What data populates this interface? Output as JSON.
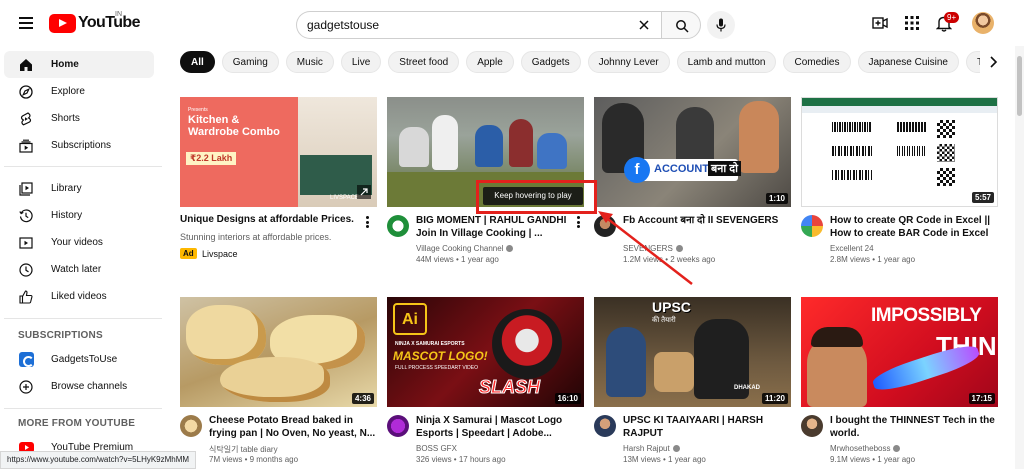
{
  "header": {
    "logo_text": "YouTube",
    "logo_region": "IN",
    "search_value": "gadgetstouse",
    "notification_count": "9+"
  },
  "sidebar": {
    "primary": [
      {
        "label": "Home",
        "icon": "home-icon",
        "active": true
      },
      {
        "label": "Explore",
        "icon": "compass-icon"
      },
      {
        "label": "Shorts",
        "icon": "shorts-icon"
      },
      {
        "label": "Subscriptions",
        "icon": "subscriptions-icon"
      }
    ],
    "library": [
      {
        "label": "Library",
        "icon": "library-icon"
      },
      {
        "label": "History",
        "icon": "history-icon"
      },
      {
        "label": "Your videos",
        "icon": "your-videos-icon"
      },
      {
        "label": "Watch later",
        "icon": "clock-icon"
      },
      {
        "label": "Liked videos",
        "icon": "thumbs-up-icon"
      }
    ],
    "subscriptions_heading": "SUBSCRIPTIONS",
    "subscriptions": [
      {
        "label": "GadgetsToUse",
        "icon": "channel-logo"
      },
      {
        "label": "Browse channels",
        "icon": "add-circle-icon"
      }
    ],
    "more_heading": "MORE FROM YOUTUBE",
    "more": [
      {
        "label": "YouTube Premium",
        "icon": "youtube-icon"
      }
    ]
  },
  "chips": [
    "All",
    "Gaming",
    "Music",
    "Live",
    "Street food",
    "Apple",
    "Gadgets",
    "Johnny Lever",
    "Lamb and mutton",
    "Comedies",
    "Japanese Cuisine",
    "Trailers"
  ],
  "ad": {
    "thumb_small": "Presents",
    "thumb_headline": "Kitchen & Wardrobe Combo",
    "thumb_price": "₹2.2 Lakh",
    "thumb_brand": "LIVSPACE",
    "title": "Unique Designs at affordable Prices.",
    "description": "Stunning interiors at affordable prices.",
    "badge": "Ad",
    "brand": "Livspace"
  },
  "videos": [
    {
      "title": "BIG MOMENT | RAHUL GANDHI Join In Village Cooking | ...",
      "channel": "Village Cooking Channel",
      "meta": "44M views • 1 year ago",
      "duration": "",
      "verified": true
    },
    {
      "title": "Fb Account बना दो II SEVENGERS",
      "channel": "SEVENGERS",
      "meta": "1.2M views • 2 weeks ago",
      "duration": "1:10",
      "verified": true,
      "thumb_text": "ACCOUNT",
      "thumb_text_hi": "बना दो"
    },
    {
      "title": "How to create QR Code in Excel || How to create BAR Code in Excel ...",
      "channel": "Excellent 24",
      "meta": "2.8M views • 1 year ago",
      "duration": "5:57",
      "verified": false
    },
    {
      "title": "Cheese Potato Bread baked in frying pan | No Oven, No yeast, N...",
      "channel": "식탁일기 table diary",
      "meta": "7M views • 9 months ago",
      "duration": "4:36",
      "verified": false
    },
    {
      "title": "Ninja X Samurai | Mascot Logo Esports | Speedart | Adobe...",
      "channel": "BOSS GFX",
      "meta": "326 views • 17 hours ago",
      "duration": "16:10",
      "verified": false,
      "thumb_small": "NINJA X SAMURAI ESPORTS",
      "thumb_big": "MASCOT LOGO!",
      "thumb_sub": "FULL PROCESS SPEEDART VIDEO",
      "thumb_slash": "SLASH"
    },
    {
      "title": "UPSC KI TAAIYAARI | HARSH RAJPUT",
      "channel": "Harsh Rajput",
      "meta": "13M views • 1 year ago",
      "duration": "11:20",
      "verified": true,
      "thumb_text": "UPSC",
      "thumb_text_hi": "की तैयारी",
      "thumb_tag": "DHAKAD"
    },
    {
      "title": "I bought the THINNEST Tech in the world.",
      "channel": "Mrwhosetheboss",
      "meta": "9.1M views • 1 year ago",
      "duration": "17:15",
      "verified": true,
      "thumb_text": "IMPOSSIBLY",
      "thumb_text2": "THIN"
    }
  ],
  "tooltip": "Keep hovering to play",
  "status_url": "https://www.youtube.com/watch?v=5LHyK9zMhMM",
  "colors": {
    "brand_red": "#ff0000",
    "annotation_red": "#e3211c",
    "ad_badge": "#feb800"
  }
}
